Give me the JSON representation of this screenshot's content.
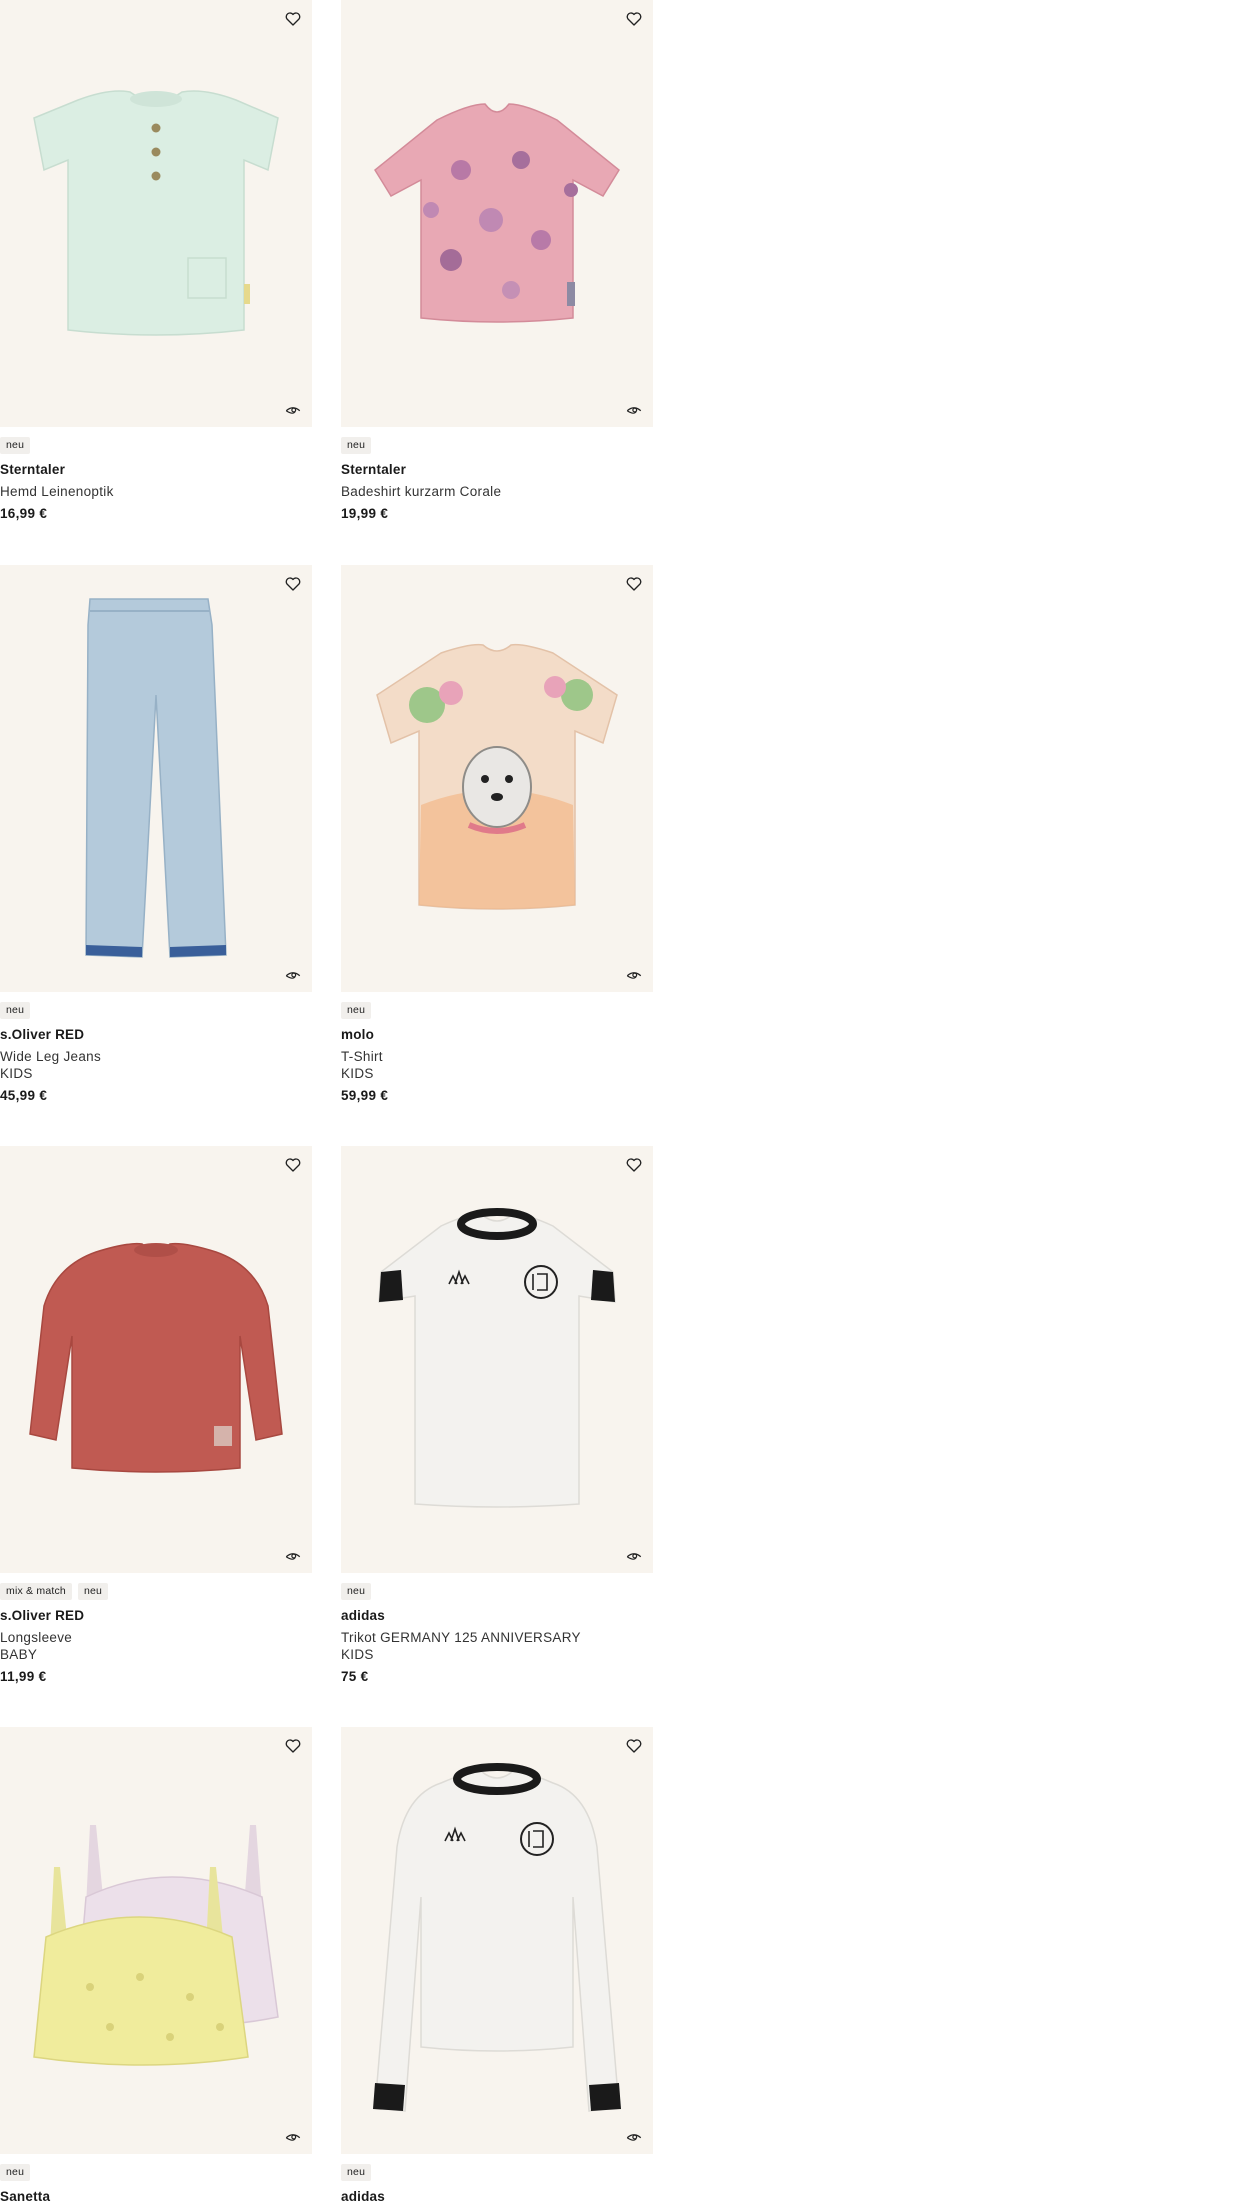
{
  "products": [
    {
      "badges": [
        "neu"
      ],
      "brand": "Sterntaler",
      "name": "Hemd Leinenoptik",
      "sub": "",
      "price": "16,99 €"
    },
    {
      "badges": [
        "neu"
      ],
      "brand": "Sterntaler",
      "name": "Badeshirt kurzarm Corale",
      "sub": "",
      "price": "19,99 €"
    },
    {
      "badges": [
        "neu"
      ],
      "brand": "s.Oliver RED",
      "name": "Wide Leg Jeans",
      "sub": "KIDS",
      "price": "45,99 €"
    },
    {
      "badges": [
        "neu"
      ],
      "brand": "molo",
      "name": "T-Shirt",
      "sub": "KIDS",
      "price": "59,99 €"
    },
    {
      "badges": [
        "mix & match",
        "neu"
      ],
      "brand": "s.Oliver RED",
      "name": "Longsleeve",
      "sub": "BABY",
      "price": "11,99 €"
    },
    {
      "badges": [
        "neu"
      ],
      "brand": "adidas",
      "name": "Trikot GERMANY 125 ANNIVERSARY",
      "sub": "KIDS",
      "price": "75 €"
    },
    {
      "badges": [
        "neu"
      ],
      "brand": "Sanetta",
      "name": "",
      "sub": "",
      "price": ""
    },
    {
      "badges": [
        "neu"
      ],
      "brand": "adidas",
      "name": "",
      "sub": "",
      "price": ""
    }
  ],
  "icons": {
    "wishlist": "heart-icon",
    "similar": "similar-items-icon"
  },
  "colors": {
    "image_bg": "#f8f4ee",
    "badge_bg": "#f1efec"
  }
}
